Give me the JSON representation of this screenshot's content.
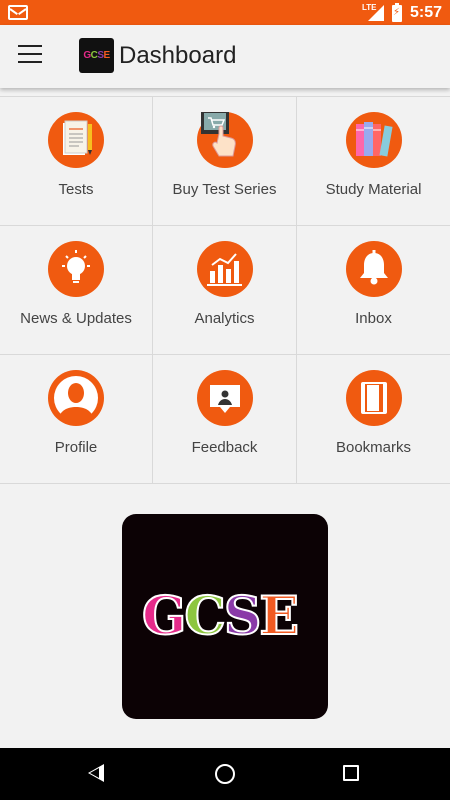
{
  "status_bar": {
    "time": "5:57",
    "network": "LTE",
    "battery_glyph": "⚡",
    "icons": [
      "gmail-icon",
      "signal-icon",
      "battery-charging-icon"
    ]
  },
  "app_bar": {
    "title": "Dashboard",
    "logo_text": "GCSE",
    "menu_icon": "hamburger-menu-icon"
  },
  "tiles": [
    {
      "label": "Tests",
      "icon": "tests-notepad-icon"
    },
    {
      "label": "Buy Test Series",
      "icon": "cart-hand-icon"
    },
    {
      "label": "Study Material",
      "icon": "books-icon"
    },
    {
      "label": "News & Updates",
      "icon": "lightbulb-icon"
    },
    {
      "label": "Analytics",
      "icon": "bar-chart-icon"
    },
    {
      "label": "Inbox",
      "icon": "bell-icon"
    },
    {
      "label": "Profile",
      "icon": "user-silhouette-icon"
    },
    {
      "label": "Feedback",
      "icon": "feedback-presenter-icon"
    },
    {
      "label": "Bookmarks",
      "icon": "bookmark-book-icon"
    }
  ],
  "banner": {
    "letters": [
      "G",
      "C",
      "S",
      "E"
    ],
    "colors": {
      "G": "#e52a8a",
      "C": "#8dc63f",
      "S": "#8a3aa8",
      "E": "#f15a22"
    }
  },
  "nav_bar": {
    "icons": [
      "back-icon",
      "home-icon",
      "recents-icon"
    ]
  },
  "colors": {
    "accent": "#f05a10",
    "background": "#f2f2f2",
    "text": "#444444"
  }
}
